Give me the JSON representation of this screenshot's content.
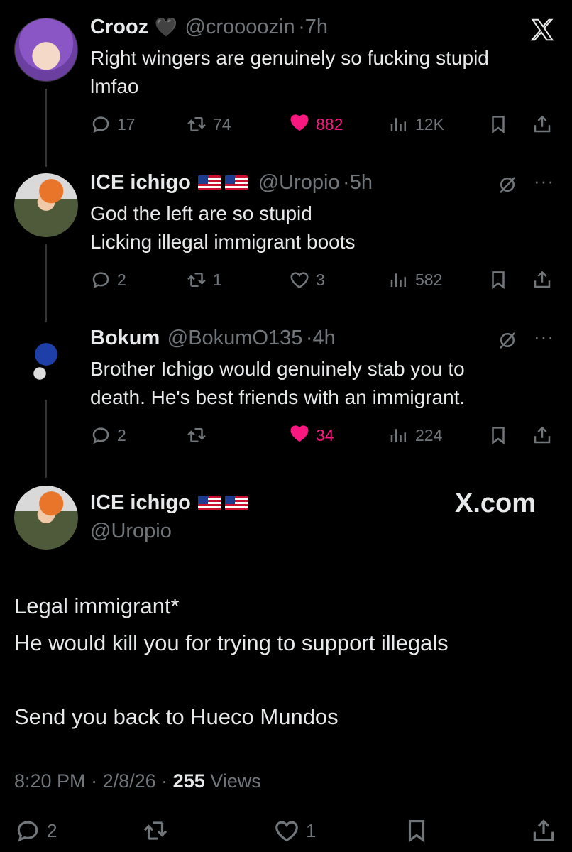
{
  "tweets": [
    {
      "name": "Crooz",
      "badge": "🖤",
      "handle": "@croooozin",
      "time": "7h",
      "text_lines": [
        "Right wingers are genuinely so fucking stupid",
        "lmfao"
      ],
      "stats": {
        "replies": "17",
        "retweets": "74",
        "likes": "882",
        "views": "12K"
      },
      "liked": true
    },
    {
      "name": "ICE ichigo",
      "handle": "@Uropio",
      "time": "5h",
      "text_lines": [
        "God the left are so stupid",
        "Licking illegal immigrant boots"
      ],
      "stats": {
        "replies": "2",
        "retweets": "1",
        "likes": "3",
        "views": "582"
      },
      "liked": false
    },
    {
      "name": "Bokum",
      "handle": "@BokumO135",
      "time": "4h",
      "text_lines": [
        "Brother Ichigo would genuinely stab you to",
        "death. He's best friends with an immigrant."
      ],
      "stats": {
        "replies": "2",
        "retweets": "",
        "likes": "34",
        "views": "224"
      },
      "liked": true
    }
  ],
  "main_tweet": {
    "name": "ICE ichigo",
    "handle": "@Uropio",
    "watermark": "X.com",
    "text_lines": [
      "Legal immigrant*",
      "He would kill you for trying to support illegals",
      "",
      "Send you back to Hueco Mundos"
    ],
    "time": "8:20 PM",
    "date": "2/8/26",
    "views_count": "255",
    "views_label": "Views",
    "stats": {
      "replies": "2",
      "retweets": "",
      "likes": "1"
    }
  },
  "icons": {
    "logo": "x-logo-icon",
    "reply": "reply-icon",
    "retweet": "retweet-icon",
    "like": "heart-icon",
    "views": "views-icon",
    "bookmark": "bookmark-icon",
    "share": "share-icon",
    "grok": "grok-icon",
    "more": "more-icon"
  },
  "colors": {
    "background": "#000000",
    "text": "#e7e9ea",
    "muted": "#71767b",
    "like": "#f91880"
  }
}
